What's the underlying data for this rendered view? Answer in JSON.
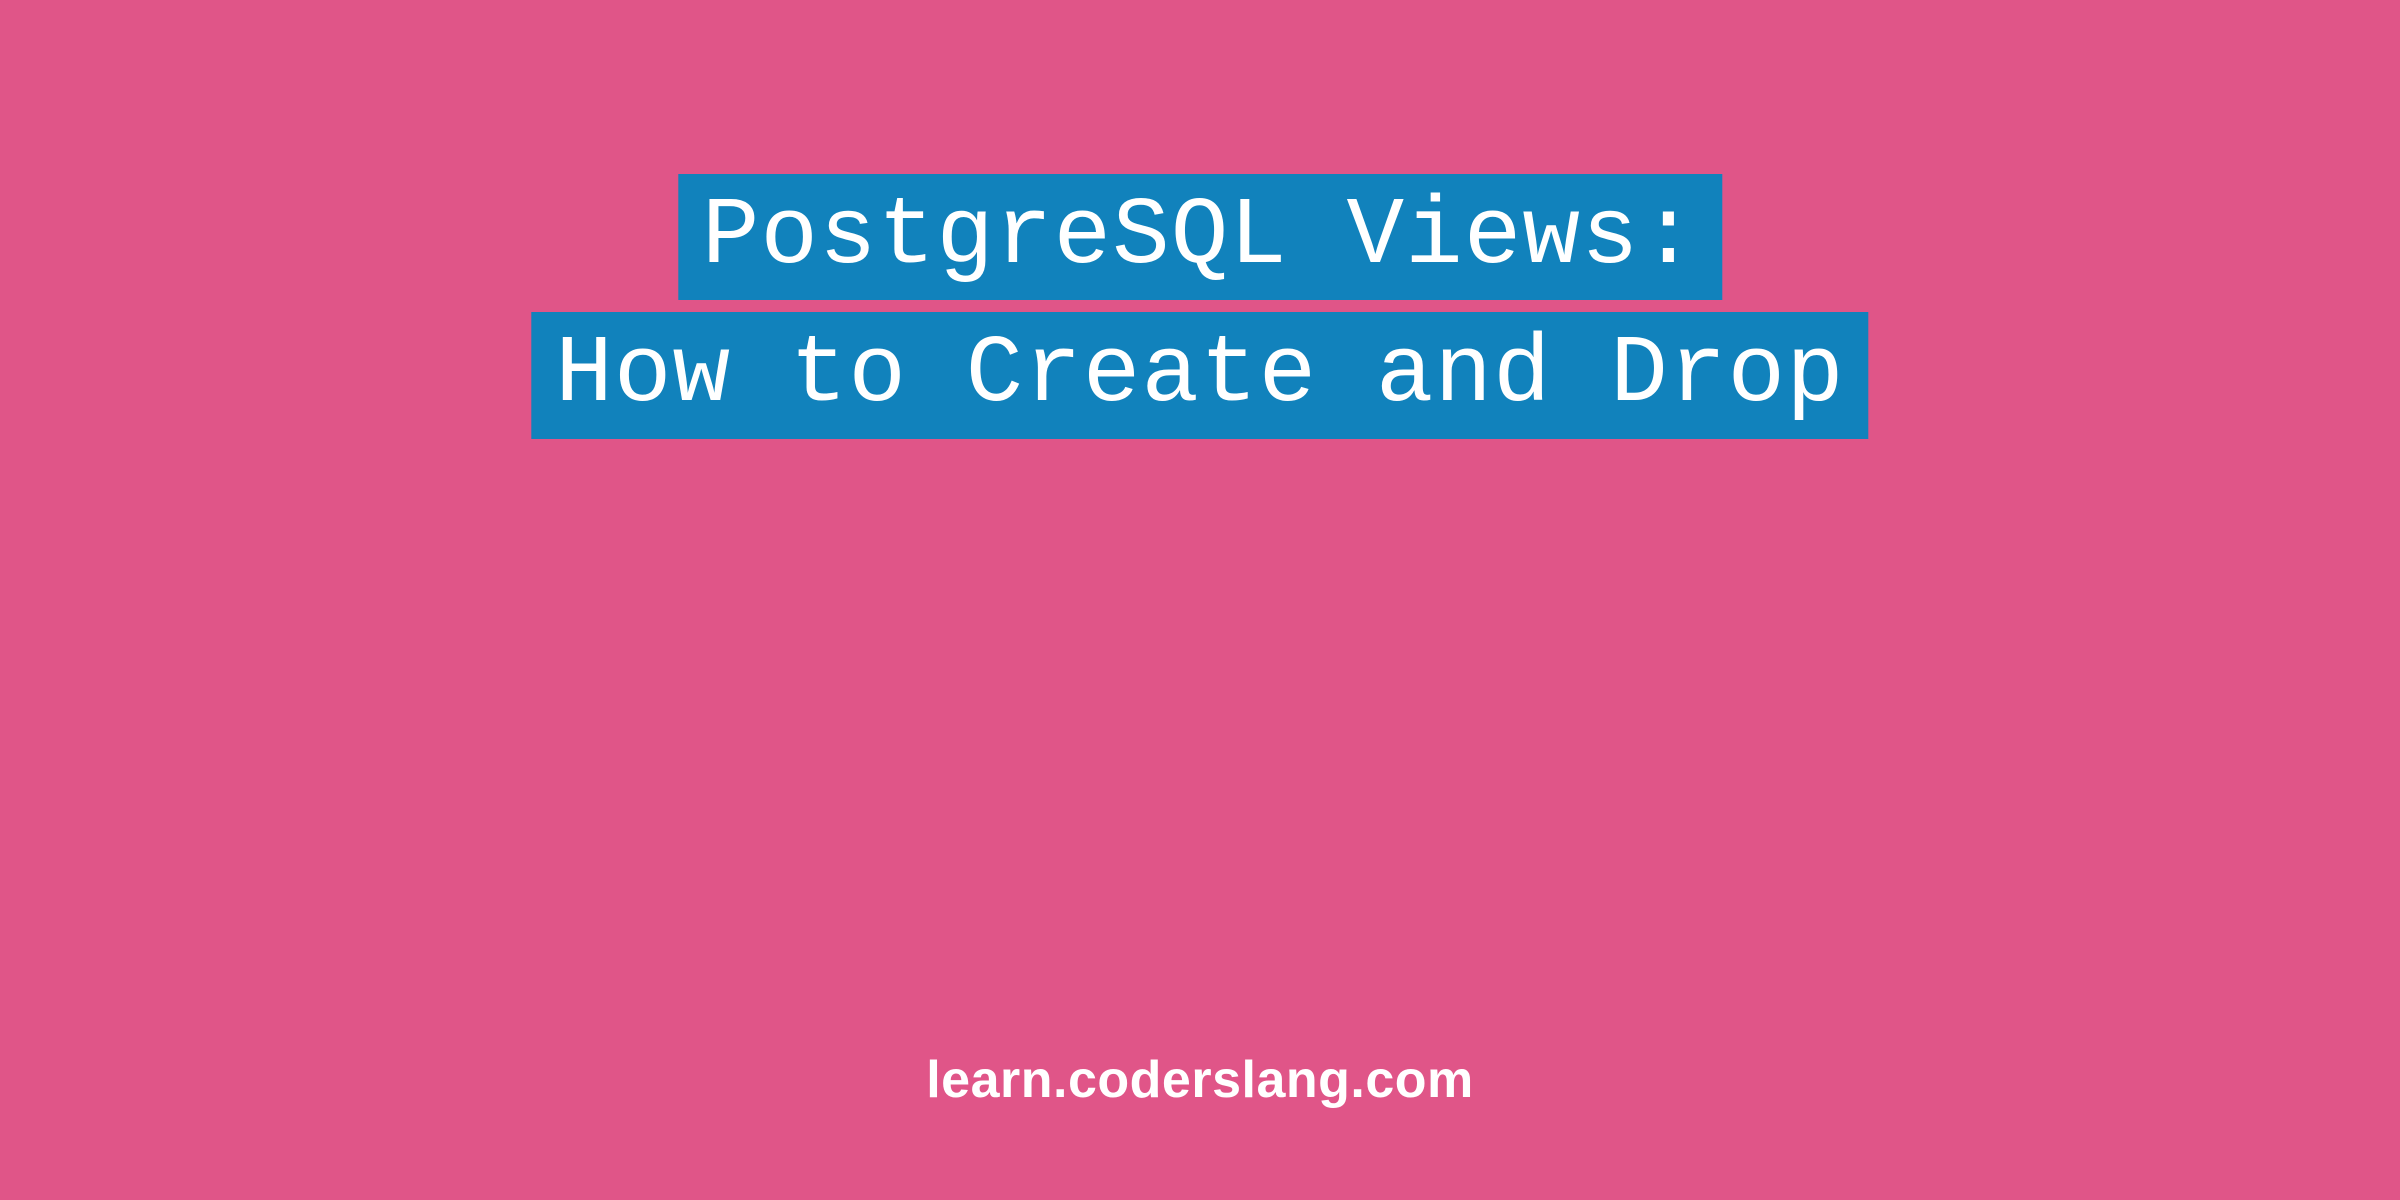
{
  "title": {
    "line1": "PostgreSQL Views:",
    "line2": "How to Create and Drop"
  },
  "footer": {
    "text": "learn.coderslang.com"
  },
  "colors": {
    "background": "#e05588",
    "highlight": "#1182bc",
    "text": "#ffffff"
  }
}
